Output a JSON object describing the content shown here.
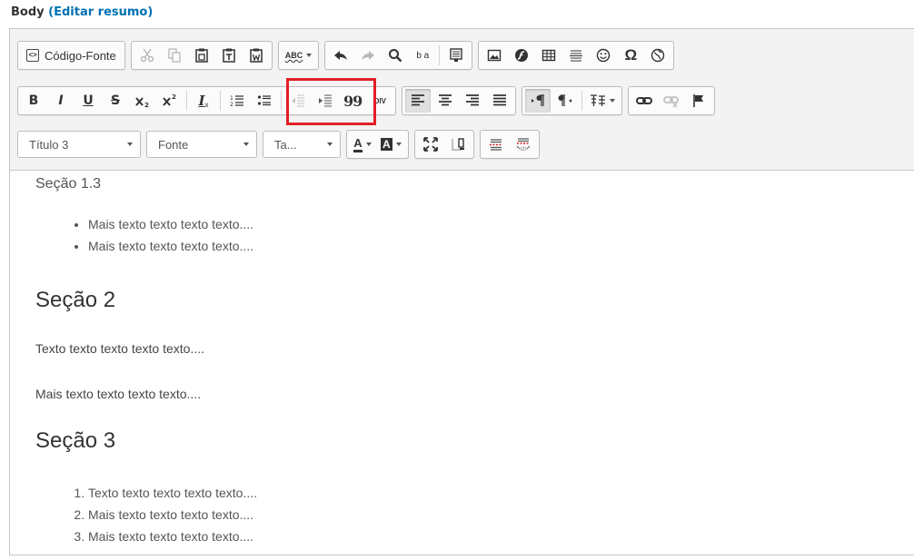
{
  "field": {
    "label": "Body",
    "link": "(Editar resumo)"
  },
  "toolbar": {
    "source_label": "Código-Fonte",
    "format_combo": "Título 3",
    "font_combo": "Fonte",
    "size_combo": "Ta...",
    "bold": "B",
    "italic": "I",
    "underline": "U",
    "strike": "S",
    "remove_format": "I",
    "text_color": "A",
    "bg_color": "A",
    "blockquote": "99",
    "omega": "Ω",
    "spell": "ABC",
    "div": "DIV",
    "replace": "b a",
    "accent_highlight": "#e21f26"
  },
  "content": {
    "section13": "Seção 1.3",
    "list1": [
      "Mais texto texto texto texto....",
      "Mais texto texto texto texto...."
    ],
    "section2": "Seção 2",
    "para1": "Texto texto texto texto texto....",
    "para2": "Mais texto texto texto texto....",
    "section3": "Seção 3",
    "list2": [
      "Texto texto texto texto texto....",
      "Mais texto texto texto texto....",
      "Mais texto texto texto texto...."
    ]
  }
}
